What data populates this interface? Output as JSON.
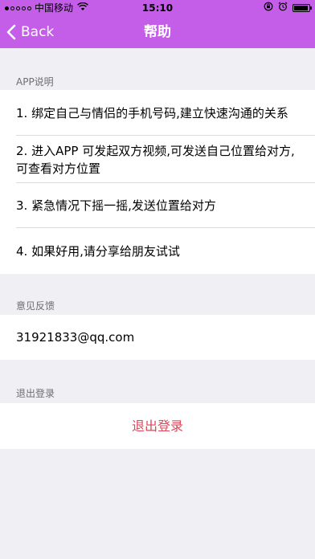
{
  "status_bar": {
    "carrier": "中国移动",
    "time": "15:10",
    "icons": [
      "signal-dots-icon",
      "wifi-icon",
      "rotation-lock-icon",
      "alarm-icon",
      "battery-icon"
    ]
  },
  "nav": {
    "back_label": "Back",
    "title": "帮助",
    "color": "#c45ee8"
  },
  "sections": {
    "app_info": {
      "header": "APP说明",
      "items": [
        "1. 绑定自己与情侣的手机号码,建立快速沟通的关系",
        "2. 进入APP 可发起双方视频,可发送自己位置给对方,可查看对方位置",
        "3. 紧急情况下摇一摇,发送位置给对方",
        "4. 如果好用,请分享给朋友试试"
      ]
    },
    "feedback": {
      "header": "意见反馈",
      "email": "31921833@qq.com"
    },
    "logout": {
      "header": "退出登录",
      "button_label": "退出登录",
      "color": "#e0455a"
    }
  }
}
